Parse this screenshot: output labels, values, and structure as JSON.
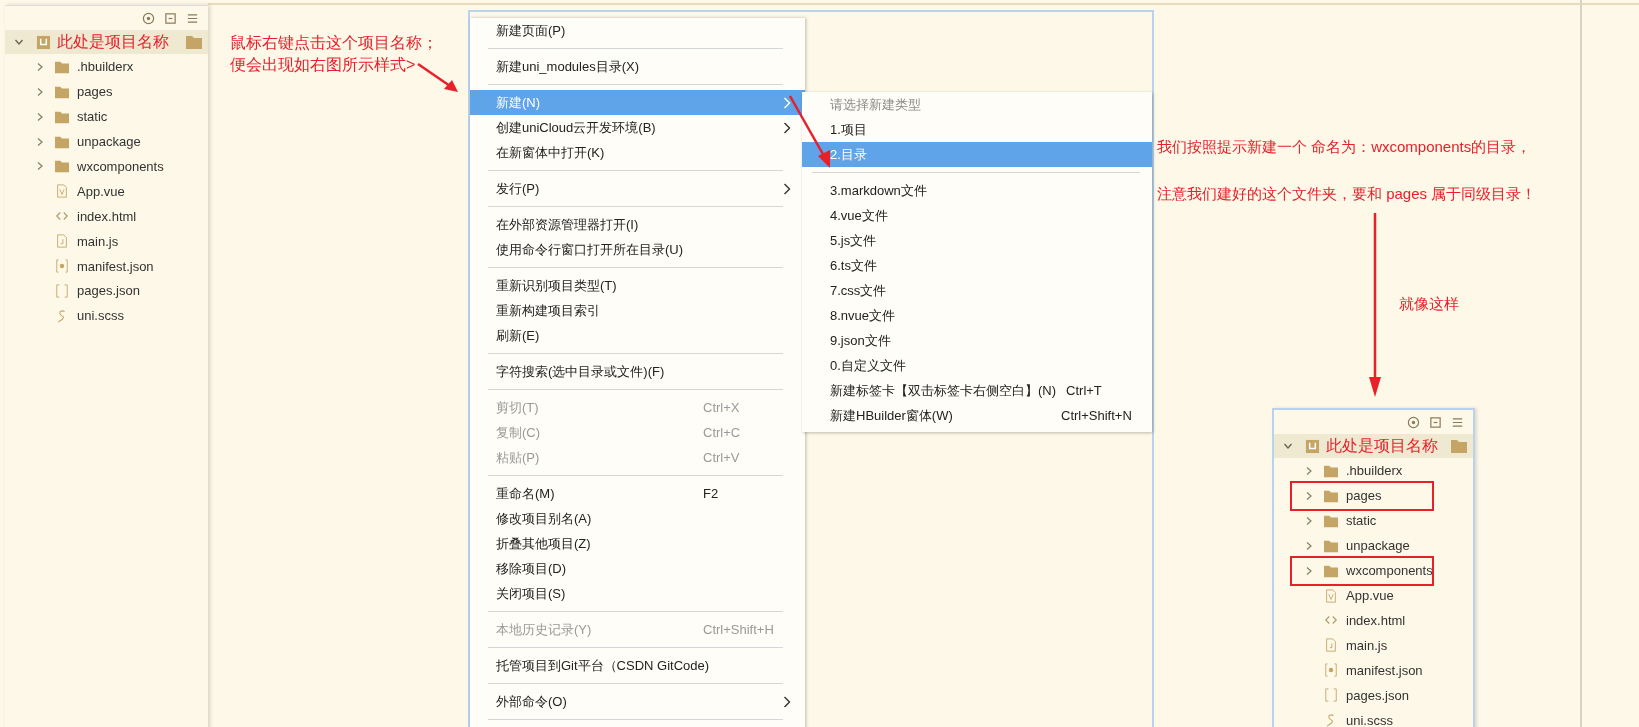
{
  "explorer": {
    "root": {
      "label": "此处是项目名称",
      "expanded": true
    },
    "items": [
      {
        "kind": "folder",
        "label": ".hbuilderx",
        "expanded": false
      },
      {
        "kind": "folder",
        "label": "pages",
        "expanded": false
      },
      {
        "kind": "folder",
        "label": "static",
        "expanded": false
      },
      {
        "kind": "folder",
        "label": "unpackage",
        "expanded": false
      },
      {
        "kind": "folder",
        "label": "wxcomponents",
        "expanded": false
      },
      {
        "kind": "vue-file",
        "label": "App.vue"
      },
      {
        "kind": "html-file",
        "label": "index.html"
      },
      {
        "kind": "js-file",
        "label": "main.js"
      },
      {
        "kind": "settings-file",
        "label": "manifest.json"
      },
      {
        "kind": "json-file",
        "label": "pages.json"
      },
      {
        "kind": "style-file",
        "label": "uni.scss"
      }
    ]
  },
  "note_left": [
    "鼠标右键点击这个项目名称；",
    "便会出现如右图所示样式>"
  ],
  "context_menu": {
    "items": [
      {
        "kind": "item",
        "label": "新建页面(P)",
        "selected": false,
        "disabled": false,
        "submenu": false
      },
      {
        "kind": "separator"
      },
      {
        "kind": "item",
        "label": "新建uni_modules目录(X)",
        "selected": false,
        "disabled": false,
        "submenu": false
      },
      {
        "kind": "separator"
      },
      {
        "kind": "item",
        "label": "新建(N)",
        "selected": true,
        "disabled": false,
        "submenu": true
      },
      {
        "kind": "item",
        "label": "创建uniCloud云开发环境(B)",
        "selected": false,
        "disabled": false,
        "submenu": true
      },
      {
        "kind": "item",
        "label": "在新窗体中打开(K)",
        "selected": false,
        "disabled": false,
        "submenu": false
      },
      {
        "kind": "separator"
      },
      {
        "kind": "item",
        "label": "发行(P)",
        "selected": false,
        "disabled": false,
        "submenu": true
      },
      {
        "kind": "separator"
      },
      {
        "kind": "item",
        "label": "在外部资源管理器打开(I)",
        "selected": false,
        "disabled": false,
        "submenu": false
      },
      {
        "kind": "item",
        "label": "使用命令行窗口打开所在目录(U)",
        "selected": false,
        "disabled": false,
        "submenu": false
      },
      {
        "kind": "separator"
      },
      {
        "kind": "item",
        "label": "重新识别项目类型(T)",
        "selected": false,
        "disabled": false,
        "submenu": false
      },
      {
        "kind": "item",
        "label": "重新构建项目索引",
        "selected": false,
        "disabled": false,
        "submenu": false
      },
      {
        "kind": "item",
        "label": "刷新(E)",
        "selected": false,
        "disabled": false,
        "submenu": false
      },
      {
        "kind": "separator"
      },
      {
        "kind": "item",
        "label": "字符搜索(选中目录或文件)(F)",
        "selected": false,
        "disabled": false,
        "submenu": false
      },
      {
        "kind": "separator"
      },
      {
        "kind": "item",
        "label": "剪切(T)",
        "shortcut": "Ctrl+X",
        "selected": false,
        "disabled": true,
        "submenu": false
      },
      {
        "kind": "item",
        "label": "复制(C)",
        "shortcut": "Ctrl+C",
        "selected": false,
        "disabled": true,
        "submenu": false
      },
      {
        "kind": "item",
        "label": "粘贴(P)",
        "shortcut": "Ctrl+V",
        "selected": false,
        "disabled": true,
        "submenu": false
      },
      {
        "kind": "separator"
      },
      {
        "kind": "item",
        "label": "重命名(M)",
        "shortcut": "F2",
        "selected": false,
        "disabled": false,
        "submenu": false
      },
      {
        "kind": "item",
        "label": "修改项目别名(A)",
        "selected": false,
        "disabled": false,
        "submenu": false
      },
      {
        "kind": "item",
        "label": "折叠其他项目(Z)",
        "selected": false,
        "disabled": false,
        "submenu": false
      },
      {
        "kind": "item",
        "label": "移除项目(D)",
        "selected": false,
        "disabled": false,
        "submenu": false
      },
      {
        "kind": "item",
        "label": "关闭项目(S)",
        "selected": false,
        "disabled": false,
        "submenu": false
      },
      {
        "kind": "separator"
      },
      {
        "kind": "item",
        "label": "本地历史记录(Y)",
        "shortcut": "Ctrl+Shift+H",
        "selected": false,
        "disabled": true,
        "submenu": false
      },
      {
        "kind": "separator"
      },
      {
        "kind": "item",
        "label": "托管项目到Git平台（CSDN GitCode)",
        "selected": false,
        "disabled": false,
        "submenu": false
      },
      {
        "kind": "separator"
      },
      {
        "kind": "item",
        "label": "外部命令(O)",
        "selected": false,
        "disabled": false,
        "submenu": true
      },
      {
        "kind": "separator"
      }
    ]
  },
  "submenu": {
    "items": [
      {
        "kind": "header",
        "label": "请选择新建类型"
      },
      {
        "kind": "item",
        "label": "1.项目",
        "selected": false
      },
      {
        "kind": "item",
        "label": "2.目录",
        "selected": true
      },
      {
        "kind": "separator"
      },
      {
        "kind": "item",
        "label": "3.markdown文件",
        "selected": false
      },
      {
        "kind": "item",
        "label": "4.vue文件",
        "selected": false
      },
      {
        "kind": "item",
        "label": "5.js文件",
        "selected": false
      },
      {
        "kind": "item",
        "label": "6.ts文件",
        "selected": false
      },
      {
        "kind": "item",
        "label": "7.css文件",
        "selected": false
      },
      {
        "kind": "item",
        "label": "8.nvue文件",
        "selected": false
      },
      {
        "kind": "item",
        "label": "9.json文件",
        "selected": false
      },
      {
        "kind": "item",
        "label": "0.自定义文件",
        "selected": false
      },
      {
        "kind": "item",
        "label": "新建标签卡【双击标签卡右侧空白】(N)",
        "shortcut": "Ctrl+T",
        "selected": false
      },
      {
        "kind": "item",
        "label": "新建HBuilder窗体(W)",
        "shortcut": "Ctrl+Shift+N",
        "selected": false
      }
    ]
  },
  "notes_right": [
    "我们按照提示新建一个 命名为：wxcomponents的目录，",
    "注意我们建好的这个文件夹，要和 pages 属于同级目录！"
  ],
  "note_result": "就像这样",
  "explorer_result": {
    "root": {
      "label": "此处是项目名称",
      "expanded": true
    },
    "items": [
      {
        "kind": "folder",
        "label": ".hbuilderx",
        "expanded": false,
        "highlighted": false
      },
      {
        "kind": "folder",
        "label": "pages",
        "expanded": false,
        "highlighted": true
      },
      {
        "kind": "folder",
        "label": "static",
        "expanded": false,
        "highlighted": false
      },
      {
        "kind": "folder",
        "label": "unpackage",
        "expanded": false,
        "highlighted": false
      },
      {
        "kind": "folder",
        "label": "wxcomponents",
        "expanded": false,
        "highlighted": true
      },
      {
        "kind": "vue-file",
        "label": "App.vue",
        "highlighted": false
      },
      {
        "kind": "html-file",
        "label": "index.html",
        "highlighted": false
      },
      {
        "kind": "js-file",
        "label": "main.js",
        "highlighted": false
      },
      {
        "kind": "settings-file",
        "label": "manifest.json",
        "highlighted": false
      },
      {
        "kind": "json-file",
        "label": "pages.json",
        "highlighted": false
      },
      {
        "kind": "style-file",
        "label": "uni.scss",
        "highlighted": false
      }
    ]
  }
}
